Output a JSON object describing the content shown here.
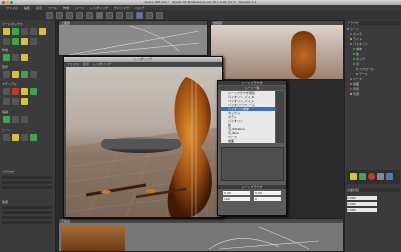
{
  "window": {
    "title": "Scene 000.shd * - Shade 3D Professional ver.15.1.0.94 (C) 3...",
    "title_short": "Scene 000.shd * - Shade 3D Professional ver.15.1.0.94 (C) 3... OpenGL 4.1"
  },
  "menubar": [
    "ファイル",
    "編集",
    "表示",
    "ツール",
    "作成",
    "シーン",
    "レンダリング",
    "ウインドウ",
    "ヘルプ"
  ],
  "left_panel": {
    "section_labels": [
      "ツールボックス",
      "作成",
      "形状",
      "マテリアル",
      "情報",
      "シーン"
    ],
    "footer_label": "ブラウザ",
    "footer_item": "情報"
  },
  "viewports": {
    "top_left_label": "上面図",
    "top_right_label": "透視図",
    "bottom_label": "正面図"
  },
  "render_window": {
    "title": "レンダリング",
    "menu": [
      "ファイル",
      "表示",
      "レンダリング"
    ]
  },
  "dialog": {
    "title": "シーンブラウザ",
    "list_header": "シーン一覧",
    "items": [
      "シーンブラウザ項目",
      "バイオリン_バイ_R",
      "バイオリン_バイ_L",
      "バイオリンフレーム",
      "バイオリン本体",
      "ネック_L",
      "ボディ",
      "バイオリン",
      "弦",
      "弓_Rotation",
      "弓_Bow",
      "ベース",
      "地面"
    ],
    "selected_index": 4,
    "bottom_title": "シーンブラウザ",
    "fields": [
      "0.00",
      "0.00",
      "100",
      "0"
    ]
  },
  "right_panel": {
    "title": "ブラウザ",
    "items": [
      "シーン",
      "カメラ",
      "ライト",
      "バイオリン",
      "本体",
      "弦",
      "ネック",
      "弓",
      "スクロール",
      "テール",
      "ベース",
      "地面",
      "背景",
      "光源"
    ],
    "footer_label": "表面材質",
    "coords": [
      "0.000",
      "0.000",
      "0.000"
    ]
  },
  "colors": {
    "accent": "#3d6fbf",
    "tool_yellow": "#d8c23a",
    "tool_green": "#3fa44b",
    "tool_red": "#c0392b"
  }
}
